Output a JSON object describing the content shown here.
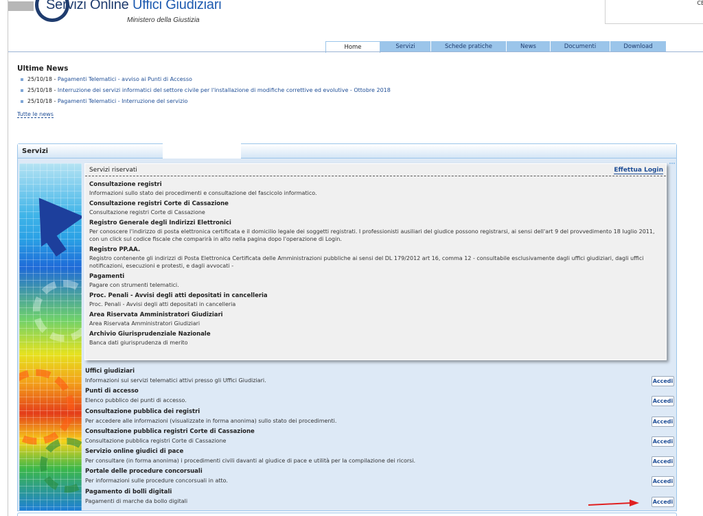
{
  "header": {
    "title_part1": "Servizi Online",
    "title_part2": "Uffici Giudiziari",
    "subtitle": "Ministero della Giustizia",
    "cert_text": "CE"
  },
  "nav": {
    "tabs": [
      {
        "label": "Home",
        "active": true
      },
      {
        "label": "Servizi",
        "active": false
      },
      {
        "label": "Schede pratiche",
        "active": false
      },
      {
        "label": "News",
        "active": false
      },
      {
        "label": "Documenti",
        "active": false
      },
      {
        "label": "Download",
        "active": false
      }
    ]
  },
  "news": {
    "title": "Ultime News",
    "items": [
      {
        "date": "25/10/18 - ",
        "text": "Pagamenti Telematici - avviso ai Punti di Accesso"
      },
      {
        "date": "25/10/18 - ",
        "text": "Interruzione dei servizi informatici del settore civile per l'installazione di modifiche correttive ed evolutive - Ottobre 2018"
      },
      {
        "date": "25/10/18 - ",
        "text": "Pagamenti Telematici - Interruzione del servizio"
      }
    ],
    "all_link": "Tutte le news"
  },
  "servizi": {
    "title": "Servizi",
    "reserved_title": "Servizi riservati",
    "login_link": "Effettua Login",
    "reserved_items": [
      {
        "title": "Consultazione registri",
        "desc": "Informazioni sullo stato dei procedimenti e consultazione del fascicolo informatico."
      },
      {
        "title": "Consultazione registri Corte di Cassazione",
        "desc": "Consultazione registri Corte di Cassazione"
      },
      {
        "title": "Registro Generale degli Indirizzi Elettronici",
        "desc": "Per conoscere l'indirizzo di posta elettronica certificata e il domicilio legale dei soggetti registrati. I professionisti ausiliari del giudice possono registrarsi, ai sensi dell'art 9 del provvedimento 18 luglio 2011, con un click sul codice fiscale che comparirà in alto nella pagina dopo l'operazione di Login."
      },
      {
        "title": "Registro PP.AA.",
        "desc": "Registro contenente gli indirizzi di Posta Elettronica Certificata delle Amministrazioni pubbliche ai sensi del DL 179/2012 art 16, comma 12 - consultabile esclusivamente dagli uffici giudiziari, dagli uffici notificazioni, esecuzioni e protesti, e dagli avvocati -"
      },
      {
        "title": "Pagamenti",
        "desc": "Pagare con strumenti telematici."
      },
      {
        "title": "Proc. Penali - Avvisi degli atti depositati in cancelleria",
        "desc": "Proc. Penali - Avvisi degli atti depositati in cancelleria"
      },
      {
        "title": "Area Riservata Amministratori Giudiziari",
        "desc": "Area Riservata Amministratori Giudiziari"
      },
      {
        "title": "Archivio Giurisprudenziale Nazionale",
        "desc": "Banca dati giurisprudenza di merito"
      }
    ],
    "public_items": [
      {
        "title": "Uffici giudiziari",
        "desc": "Informazioni sui servizi telematici attivi presso gli Uffici Giudiziari.",
        "button": "Accedi"
      },
      {
        "title": "Punti di accesso",
        "desc": "Elenco pubblico dei punti di accesso.",
        "button": "Accedi"
      },
      {
        "title": "Consultazione pubblica dei registri",
        "desc": "Per accedere alle informazioni (visualizzate in forma anonima) sullo stato dei procedimenti.",
        "button": "Accedi"
      },
      {
        "title": "Consultazione pubblica registri Corte di Cassazione",
        "desc": "Consultazione pubblica registri Corte di Cassazione",
        "button": "Accedi"
      },
      {
        "title": "Servizio online giudici di pace",
        "desc": "Per consultare (in forma anonima) i procedimenti civili davanti al giudice di pace e utilità per la compilazione dei ricorsi.",
        "button": "Accedi"
      },
      {
        "title": "Portale delle procedure concorsuali",
        "desc": "Per informazioni sulle procedure concorsuali in atto.",
        "button": "Accedi"
      },
      {
        "title": "Pagamento di bolli digitali",
        "desc": "Pagamenti di marche da bollo digitali",
        "button": "Accedi"
      }
    ]
  },
  "colors": {
    "brand": "#1f3c6e",
    "link": "#1f4e96",
    "tab_bg": "#9bc5ea",
    "panel_bg": "#dde9f6",
    "annotation_arrow": "#e02020"
  }
}
